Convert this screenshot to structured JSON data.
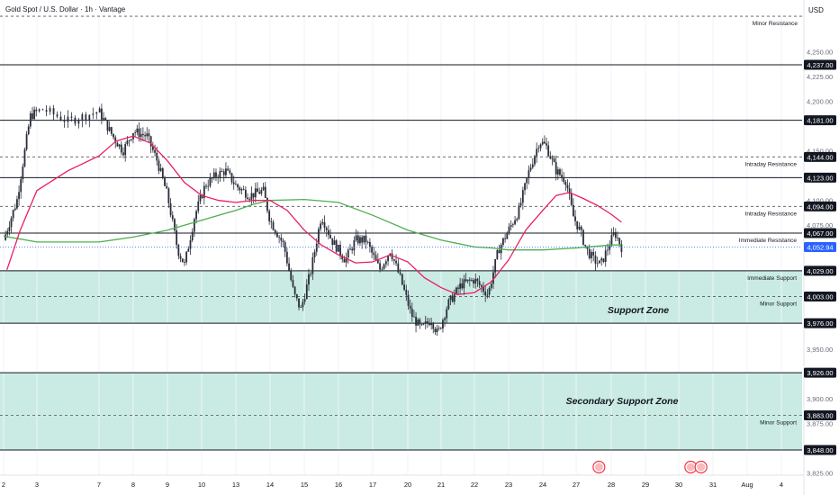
{
  "header": {
    "title": "Gold Spot / U.S. Dollar · 1h · Vantage"
  },
  "axis": {
    "currency": "USD"
  },
  "colors": {
    "bullish": "#089981",
    "bearish": "#f23645",
    "candle": "#2a2e39",
    "ema_fast": "#e91e63",
    "ema_slow": "#4caf50",
    "zone_fill": "#b2e3d7",
    "level_line": "#131722",
    "current_price_bg": "#2962ff"
  },
  "chart_data": {
    "type": "candlestick",
    "symbol": "Gold Spot / U.S. Dollar",
    "timeframe": "1h",
    "broker": "Vantage",
    "ylim": [
      3820,
      4300
    ],
    "y_ticks": [
      "4,250.00",
      "4,225.00",
      "4,200.00",
      "4,150.00",
      "4,100.00",
      "4,075.00",
      "3,950.00",
      "3,900.00",
      "3,875.00",
      "3,825.00"
    ],
    "x_ticks": [
      "2",
      "3",
      "7",
      "8",
      "9",
      "10",
      "13",
      "14",
      "15",
      "16",
      "17",
      "20",
      "21",
      "22",
      "23",
      "24",
      "27",
      "28",
      "29",
      "30",
      "31",
      "Aug",
      "4"
    ],
    "current_price": {
      "value": 4052.94,
      "label": "4,052.94"
    },
    "levels": [
      {
        "value": 4237.0,
        "label": "4,237.00",
        "style": "solid",
        "annotation": ""
      },
      {
        "value": 4181.0,
        "label": "4,181.00",
        "style": "solid",
        "annotation": ""
      },
      {
        "value": 4144.0,
        "label": "4,144.00",
        "style": "dashed",
        "annotation": "Intraday Resistance"
      },
      {
        "value": 4123.0,
        "label": "4,123.00",
        "style": "solid",
        "annotation": ""
      },
      {
        "value": 4094.0,
        "label": "4,094.00",
        "style": "dashed",
        "annotation": "Intraday Resistance"
      },
      {
        "value": 4067.0,
        "label": "4,067.00",
        "style": "solid",
        "annotation": "Immediate Resistance"
      },
      {
        "value": 4029.0,
        "label": "4,029.00",
        "style": "solid",
        "annotation": "Immediate Support"
      },
      {
        "value": 4003.0,
        "label": "4,003.00",
        "style": "dashed",
        "annotation": "Minor Support"
      },
      {
        "value": 3976.0,
        "label": "3,976.00",
        "style": "solid",
        "annotation": ""
      },
      {
        "value": 3926.0,
        "label": "3,926.00",
        "style": "solid",
        "annotation": ""
      },
      {
        "value": 3883.0,
        "label": "3,883.00",
        "style": "dashed",
        "annotation": "Minor Support"
      },
      {
        "value": 3848.0,
        "label": "3,848.00",
        "style": "solid",
        "annotation": ""
      }
    ],
    "top_level": {
      "value": 4286,
      "style": "dashed",
      "annotation": "Minor Resistance"
    },
    "zones": [
      {
        "name": "Support Zone",
        "from": 3976,
        "to": 4029
      },
      {
        "name": "Secondary Support Zone",
        "from": 3848,
        "to": 3926
      }
    ],
    "price_path": [
      [
        0,
        4060
      ],
      [
        0.4,
        4100
      ],
      [
        0.8,
        4185
      ],
      [
        1.1,
        4192
      ],
      [
        1.5,
        4180
      ],
      [
        2.0,
        4190
      ],
      [
        2.4,
        4165
      ],
      [
        2.7,
        4150
      ],
      [
        3.0,
        4170
      ],
      [
        3.4,
        4165
      ],
      [
        3.7,
        4140
      ],
      [
        4.0,
        4105
      ],
      [
        4.3,
        4050
      ],
      [
        4.5,
        4035
      ],
      [
        4.8,
        4085
      ],
      [
        5.1,
        4115
      ],
      [
        5.4,
        4125
      ],
      [
        5.7,
        4130
      ],
      [
        6.0,
        4115
      ],
      [
        6.4,
        4105
      ],
      [
        6.8,
        4110
      ],
      [
        7.0,
        4080
      ],
      [
        7.4,
        4055
      ],
      [
        7.7,
        4005
      ],
      [
        7.9,
        3990
      ],
      [
        8.2,
        4030
      ],
      [
        8.5,
        4085
      ],
      [
        8.8,
        4060
      ],
      [
        9.2,
        4040
      ],
      [
        9.5,
        4060
      ],
      [
        9.8,
        4060
      ],
      [
        10.2,
        4030
      ],
      [
        10.5,
        4050
      ],
      [
        10.8,
        4020
      ],
      [
        11.1,
        3985
      ],
      [
        11.4,
        3970
      ],
      [
        11.7,
        3980
      ],
      [
        11.9,
        3965
      ],
      [
        12.2,
        3995
      ],
      [
        12.6,
        4015
      ],
      [
        13.0,
        4020
      ],
      [
        13.4,
        4005
      ],
      [
        13.7,
        4050
      ],
      [
        14.0,
        4070
      ],
      [
        14.3,
        4090
      ],
      [
        14.6,
        4130
      ],
      [
        14.9,
        4160
      ],
      [
        15.1,
        4155
      ],
      [
        15.4,
        4130
      ],
      [
        15.7,
        4120
      ],
      [
        15.9,
        4085
      ],
      [
        16.1,
        4070
      ],
      [
        16.3,
        4050
      ],
      [
        16.5,
        4040
      ],
      [
        16.7,
        4035
      ],
      [
        16.9,
        4052
      ],
      [
        17.1,
        4068
      ],
      [
        17.3,
        4052.94
      ]
    ],
    "ema_fast": [
      [
        0.1,
        4030
      ],
      [
        0.5,
        4070
      ],
      [
        1.0,
        4110
      ],
      [
        1.5,
        4130
      ],
      [
        2.0,
        4145
      ],
      [
        2.5,
        4160
      ],
      [
        3.0,
        4165
      ],
      [
        3.5,
        4158
      ],
      [
        4.0,
        4140
      ],
      [
        4.5,
        4118
      ],
      [
        5.0,
        4105
      ],
      [
        5.5,
        4100
      ],
      [
        6.0,
        4098
      ],
      [
        6.5,
        4100
      ],
      [
        7.0,
        4100
      ],
      [
        7.5,
        4090
      ],
      [
        8.0,
        4070
      ],
      [
        8.5,
        4055
      ],
      [
        9.0,
        4045
      ],
      [
        9.5,
        4037
      ],
      [
        10.0,
        4038
      ],
      [
        10.5,
        4045
      ],
      [
        11.0,
        4038
      ],
      [
        11.5,
        4022
      ],
      [
        12.0,
        4012
      ],
      [
        12.5,
        4005
      ],
      [
        13.0,
        4007
      ],
      [
        13.5,
        4018
      ],
      [
        14.0,
        4040
      ],
      [
        14.5,
        4070
      ],
      [
        15.0,
        4090
      ],
      [
        15.4,
        4105
      ],
      [
        15.8,
        4108
      ],
      [
        16.2,
        4102
      ],
      [
        16.6,
        4095
      ],
      [
        17.0,
        4086
      ],
      [
        17.3,
        4078
      ]
    ],
    "ema_slow": [
      [
        0,
        4064
      ],
      [
        1,
        4058
      ],
      [
        2,
        4058
      ],
      [
        3,
        4063
      ],
      [
        4,
        4070
      ],
      [
        5,
        4080
      ],
      [
        6,
        4090
      ],
      [
        6.5,
        4096
      ],
      [
        7,
        4100
      ],
      [
        8,
        4101
      ],
      [
        9,
        4098
      ],
      [
        10,
        4085
      ],
      [
        11,
        4070
      ],
      [
        12,
        4060
      ],
      [
        13,
        4053
      ],
      [
        13.5,
        4052
      ],
      [
        14,
        4050
      ],
      [
        15,
        4050
      ],
      [
        16,
        4052
      ],
      [
        17,
        4055
      ],
      [
        17.3,
        4055
      ]
    ],
    "event_markers": [
      {
        "x_tick": "28",
        "offset": -0.35
      },
      {
        "x_tick": "30",
        "offset": 0.35
      },
      {
        "x_tick": "31",
        "offset": -0.35
      }
    ]
  }
}
